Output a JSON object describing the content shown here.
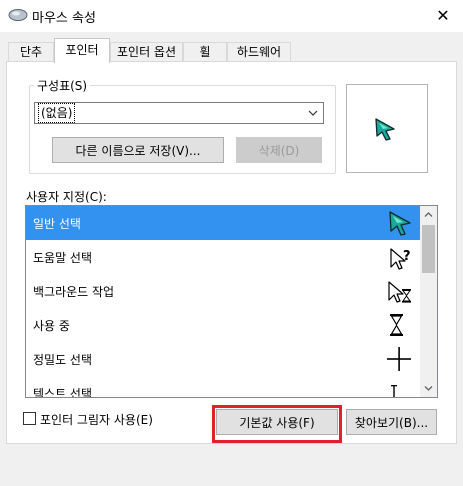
{
  "window": {
    "title": "마우스 속성",
    "close_glyph": "✕"
  },
  "tabs": [
    {
      "label": "단추",
      "active": false
    },
    {
      "label": "포인터",
      "active": true
    },
    {
      "label": "포인터 옵션",
      "active": false
    },
    {
      "label": "휠",
      "active": false
    },
    {
      "label": "하드웨어",
      "active": false
    }
  ],
  "scheme": {
    "label": "구성표(S)",
    "selected": "(없음)",
    "save_as_label": "다른 이름으로 저장(V)...",
    "delete_label": "삭제(D)"
  },
  "customize": {
    "label": "사용자 지정(C):",
    "items": [
      {
        "label": "일반 선택",
        "icon": "normal-select-cursor-icon",
        "selected": true
      },
      {
        "label": "도움말 선택",
        "icon": "help-select-cursor-icon",
        "selected": false
      },
      {
        "label": "백그라운드 작업",
        "icon": "working-in-background-cursor-icon",
        "selected": false
      },
      {
        "label": "사용 중",
        "icon": "busy-hourglass-cursor-icon",
        "selected": false
      },
      {
        "label": "정밀도 선택",
        "icon": "precision-select-crosshair-icon",
        "selected": false
      },
      {
        "label": "텍스트 선택",
        "icon": "text-select-ibeam-icon",
        "selected": false
      }
    ]
  },
  "shadow_checkbox": {
    "label": "포인터 그림자 사용(E)",
    "checked": false
  },
  "buttons": {
    "use_default": "기본값 사용(F)",
    "browse": "찾아보기(B)..."
  },
  "colors": {
    "selection": "#3391f0",
    "highlight_box": "#e0202a",
    "cursor_teal": "#1aa89a"
  }
}
